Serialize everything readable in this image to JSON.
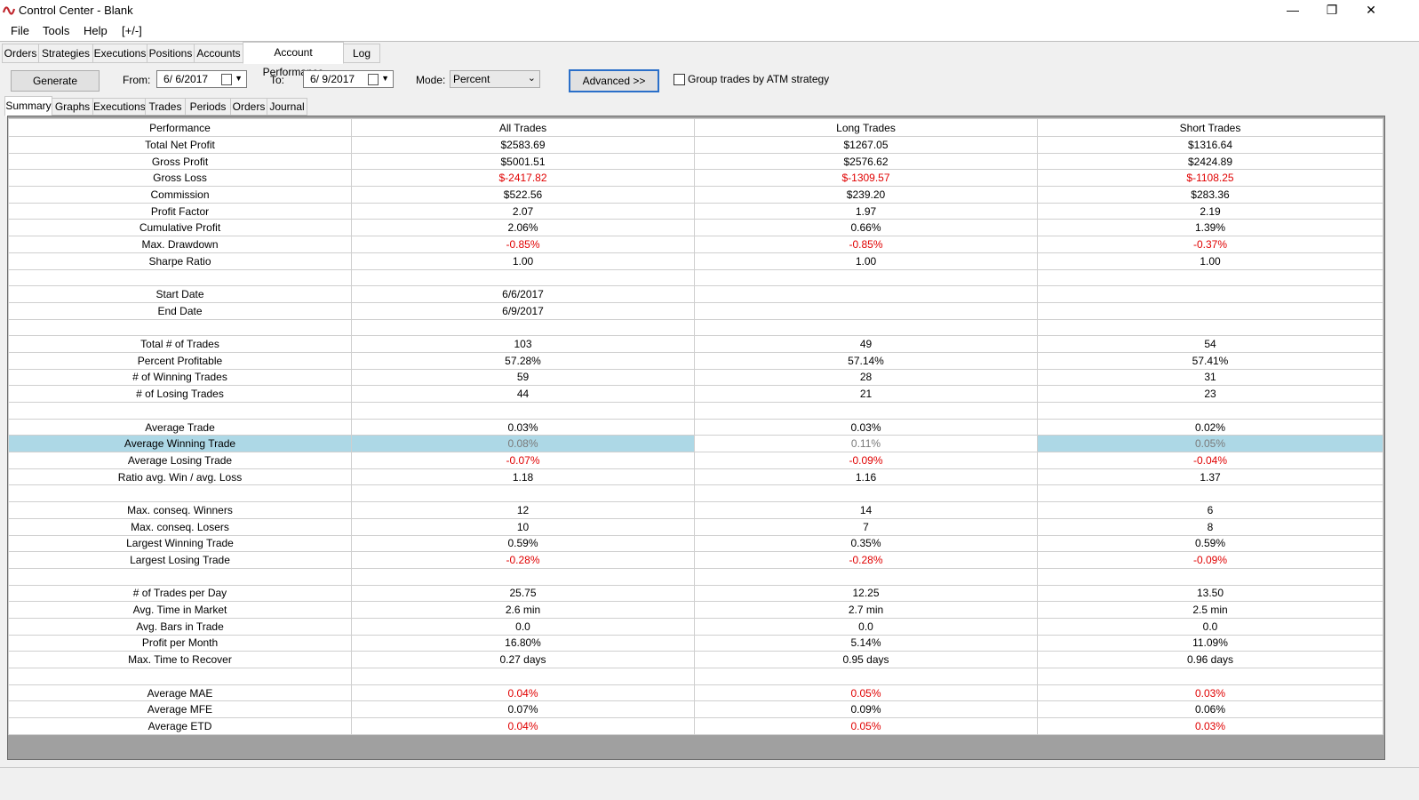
{
  "window": {
    "title": "Control Center - Blank",
    "minimize": "—",
    "restore": "❐",
    "close": "✕"
  },
  "menu": [
    "File",
    "Tools",
    "Help",
    "[+/-]"
  ],
  "main_tabs": [
    "Orders",
    "Strategies",
    "Executions",
    "Positions",
    "Accounts",
    "Account Performance",
    "Log"
  ],
  "toolbar": {
    "generate_label": "Generate",
    "from_label": "From:",
    "from_value": "6/  6/2017",
    "to_label": "To:",
    "to_value": "6/  9/2017",
    "mode_label": "Mode:",
    "mode_value": "Percent",
    "advanced_label": "Advanced >>",
    "group_label": "Group trades by ATM strategy",
    "group_checked": false
  },
  "sub_tabs": [
    "Summary",
    "Graphs",
    "Executions",
    "Trades",
    "Periods",
    "Orders",
    "Journal"
  ],
  "grid": {
    "headers": [
      "Performance",
      "All Trades",
      "Long Trades",
      "Short Trades"
    ],
    "rows": [
      [
        "Total Net Profit",
        "$2583.69",
        "$1267.05",
        "$1316.64"
      ],
      [
        "Gross Profit",
        "$5001.51",
        "$2576.62",
        "$2424.89"
      ],
      [
        "Gross Loss",
        "$-2417.82",
        "$-1309.57",
        "$-1108.25"
      ],
      [
        "Commission",
        "$522.56",
        "$239.20",
        "$283.36"
      ],
      [
        "Profit Factor",
        "2.07",
        "1.97",
        "2.19"
      ],
      [
        "Cumulative Profit",
        "2.06%",
        "0.66%",
        "1.39%"
      ],
      [
        "Max. Drawdown",
        "-0.85%",
        "-0.85%",
        "-0.37%"
      ],
      [
        "Sharpe Ratio",
        "1.00",
        "1.00",
        "1.00"
      ],
      [
        "",
        "",
        "",
        ""
      ],
      [
        "Start Date",
        "6/6/2017",
        "",
        ""
      ],
      [
        "End Date",
        "6/9/2017",
        "",
        ""
      ],
      [
        "",
        "",
        "",
        ""
      ],
      [
        "Total # of Trades",
        "103",
        "49",
        "54"
      ],
      [
        "Percent Profitable",
        "57.28%",
        "57.14%",
        "57.41%"
      ],
      [
        "# of Winning Trades",
        "59",
        "28",
        "31"
      ],
      [
        "# of Losing Trades",
        "44",
        "21",
        "23"
      ],
      [
        "",
        "",
        "",
        ""
      ],
      [
        "Average Trade",
        "0.03%",
        "0.03%",
        "0.02%"
      ],
      [
        "Average Winning Trade",
        "0.08%",
        "0.11%",
        "0.05%"
      ],
      [
        "Average Losing Trade",
        "-0.07%",
        "-0.09%",
        "-0.04%"
      ],
      [
        "Ratio avg. Win / avg. Loss",
        "1.18",
        "1.16",
        "1.37"
      ],
      [
        "",
        "",
        "",
        ""
      ],
      [
        "Max. conseq. Winners",
        "12",
        "14",
        "6"
      ],
      [
        "Max. conseq. Losers",
        "10",
        "7",
        "8"
      ],
      [
        "Largest Winning Trade",
        "0.59%",
        "0.35%",
        "0.59%"
      ],
      [
        "Largest Losing Trade",
        "-0.28%",
        "-0.28%",
        "-0.09%"
      ],
      [
        "",
        "",
        "",
        ""
      ],
      [
        "# of Trades per Day",
        "25.75",
        "12.25",
        "13.50"
      ],
      [
        "Avg. Time in Market",
        "2.6 min",
        "2.7 min",
        "2.5 min"
      ],
      [
        "Avg. Bars in Trade",
        "0.0",
        "0.0",
        "0.0"
      ],
      [
        "Profit per Month",
        "16.80%",
        "5.14%",
        "11.09%"
      ],
      [
        "Max. Time to Recover",
        "0.27 days",
        "0.95 days",
        "0.96 days"
      ],
      [
        "",
        "",
        "",
        ""
      ],
      [
        "Average MAE",
        "0.04%",
        "0.05%",
        "0.03%"
      ],
      [
        "Average MFE",
        "0.07%",
        "0.09%",
        "0.06%"
      ],
      [
        "Average ETD",
        "0.04%",
        "0.05%",
        "0.03%"
      ]
    ],
    "negative_rows": [
      "Gross Loss",
      "Max. Drawdown",
      "Average Losing Trade",
      "Largest Losing Trade",
      "Average MAE",
      "Average ETD"
    ],
    "selected_row": "Average Winning Trade"
  },
  "colors": {
    "negative": "#e00000",
    "selection": "#add8e6",
    "grid_bg": "#a0a0a0"
  }
}
